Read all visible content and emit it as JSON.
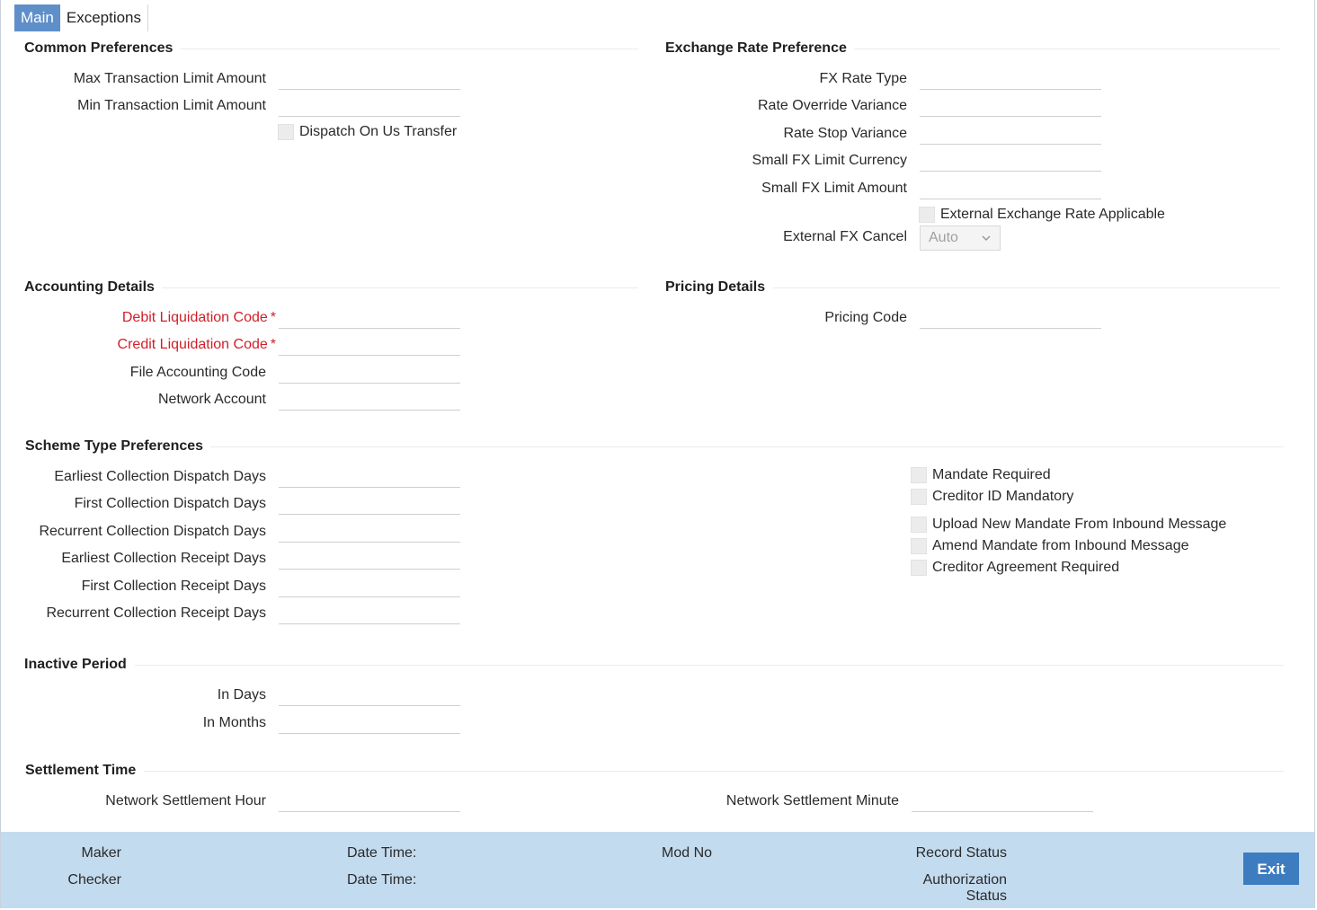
{
  "tabs": [
    {
      "label": "Main",
      "active": true
    },
    {
      "label": "Exceptions",
      "active": false
    }
  ],
  "sections": {
    "common": {
      "title": "Common Preferences",
      "max_limit_label": "Max Transaction Limit Amount",
      "min_limit_label": "Min Transaction Limit Amount",
      "dispatch_label": "Dispatch On Us Transfer"
    },
    "exchange": {
      "title": "Exchange Rate Preference",
      "fx_rate_type_label": "FX Rate Type",
      "rate_override_label": "Rate Override Variance",
      "rate_stop_label": "Rate Stop Variance",
      "small_fx_currency_label": "Small FX Limit Currency",
      "small_fx_amount_label": "Small FX Limit Amount",
      "external_rate_label": "External Exchange Rate Applicable",
      "external_cancel_label": "External FX Cancel",
      "external_cancel_value": "Auto"
    },
    "accounting": {
      "title": "Accounting Details",
      "debit_label": "Debit Liquidation Code",
      "credit_label": "Credit Liquidation Code",
      "file_label": "File Accounting Code",
      "network_label": "Network Account",
      "required_mark": "*"
    },
    "pricing": {
      "title": "Pricing Details",
      "pricing_code_label": "Pricing Code"
    },
    "scheme": {
      "title": "Scheme Type Preferences",
      "earliest_dispatch_label": "Earliest Collection Dispatch Days",
      "first_dispatch_label": "First Collection Dispatch Days",
      "recurrent_dispatch_label": "Recurrent Collection Dispatch Days",
      "earliest_receipt_label": "Earliest Collection Receipt Days",
      "first_receipt_label": "First Collection Receipt Days",
      "recurrent_receipt_label": "Recurrent Collection Receipt Days",
      "mandate_required_label": "Mandate Required",
      "creditor_id_label": "Creditor ID Mandatory",
      "upload_mandate_label": "Upload New Mandate From Inbound Message",
      "amend_mandate_label": "Amend Mandate from Inbound Message",
      "creditor_agreement_label": "Creditor Agreement Required"
    },
    "inactive": {
      "title": "Inactive Period",
      "days_label": "In Days",
      "months_label": "In Months"
    },
    "settlement": {
      "title": "Settlement Time",
      "hour_label": "Network Settlement Hour",
      "minute_label": "Network Settlement Minute"
    }
  },
  "footer": {
    "maker": "Maker",
    "checker": "Checker",
    "date_time_1": "Date Time:",
    "date_time_2": "Date Time:",
    "mod_no": "Mod No",
    "record_status": "Record Status",
    "authorization": "Authorization",
    "status": "Status",
    "exit": "Exit"
  },
  "colors": {
    "tab_active": "#5e8fc9",
    "required": "#d0202a",
    "footer_bg": "#c3dbef",
    "exit_button": "#3d7cbf"
  }
}
